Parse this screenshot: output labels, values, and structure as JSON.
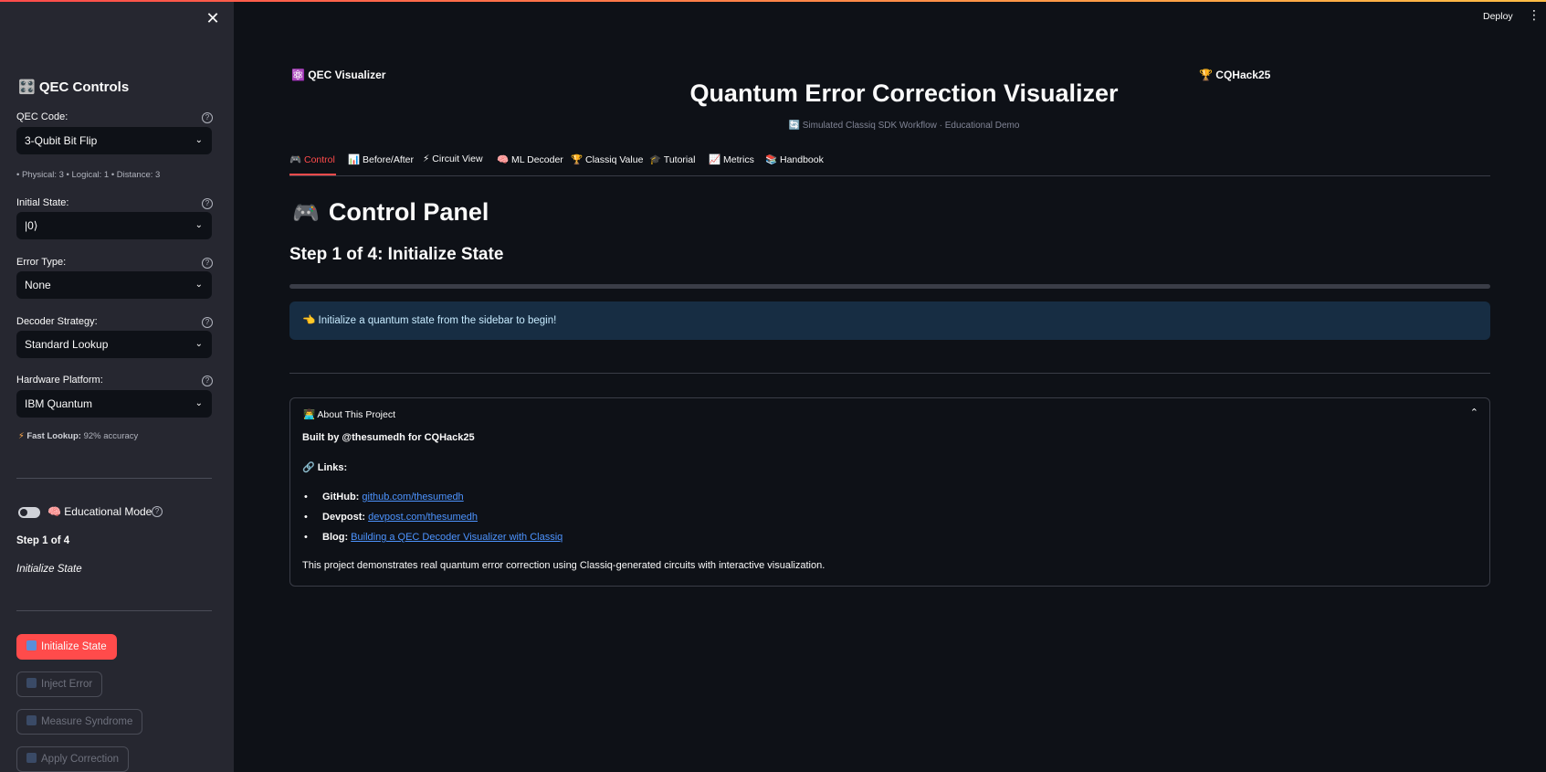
{
  "header": {
    "deploy_label": "Deploy",
    "menu_icon": "kebab-icon",
    "close_icon": "close-icon"
  },
  "sidebar": {
    "title": "🎛️ QEC Controls",
    "qec_code": {
      "label": "QEC Code:",
      "value": "3-Qubit Bit Flip"
    },
    "code_info": "• Physical: 3 • Logical: 1 • Distance: 3",
    "initial_state": {
      "label": "Initial State:",
      "value": "|0⟩"
    },
    "error_type": {
      "label": "Error Type:",
      "value": "None"
    },
    "decoder_strategy": {
      "label": "Decoder Strategy:",
      "value": "Standard Lookup"
    },
    "hardware_platform": {
      "label": "Hardware Platform:",
      "value": "IBM Quantum"
    },
    "lookup_note": {
      "strong": "Fast Lookup:",
      "text": "92% accuracy"
    },
    "educational_mode": {
      "label": "🧠 Educational Mode",
      "enabled": false
    },
    "step_label": "Step 1 of 4",
    "step_name": "Initialize State",
    "buttons": {
      "initialize": "Initialize State",
      "inject": "Inject Error",
      "measure": "Measure Syndrome",
      "apply": "Apply Correction"
    }
  },
  "main": {
    "badge_left": "⚛️ QEC Visualizer",
    "badge_right": "🏆 CQHack25",
    "title": "Quantum Error Correction Visualizer",
    "subtitle": "🔄 Simulated Classiq SDK Workflow · Educational Demo",
    "tabs": [
      {
        "label": "🎮 Control"
      },
      {
        "label": "📊 Before/After"
      },
      {
        "label": "⚡ Circuit View"
      },
      {
        "label": "🧠 ML Decoder"
      },
      {
        "label": "🏆 Classiq Value"
      },
      {
        "label": "🎓 Tutorial"
      },
      {
        "label": "📈 Metrics"
      },
      {
        "label": "📚 Handbook"
      }
    ],
    "heading_emoji": "🎮",
    "heading": "Control Panel",
    "step_heading": "Step 1 of 4: Initialize State",
    "progress": 0,
    "info": "👈 Initialize a quantum state from the sidebar to begin!",
    "about": {
      "title": "👨‍💻 About This Project",
      "built_by": "Built by @thesumedh for CQHack25",
      "links_title": "🔗 Links:",
      "links": [
        {
          "key": "GitHub:",
          "text": "github.com/thesumedh"
        },
        {
          "key": "Devpost:",
          "text": "devpost.com/thesumedh"
        },
        {
          "key": "Blog:",
          "text": "Building a QEC Decoder Visualizer with Classiq"
        }
      ],
      "description": "This project demonstrates real quantum error correction using Classiq-generated circuits with interactive visualization."
    }
  },
  "colors": {
    "accent": "#ff4b4b",
    "sidebar_bg": "#262730",
    "main_bg": "#0e1117",
    "info_bg": "#172d43",
    "link": "#4d94ff"
  }
}
